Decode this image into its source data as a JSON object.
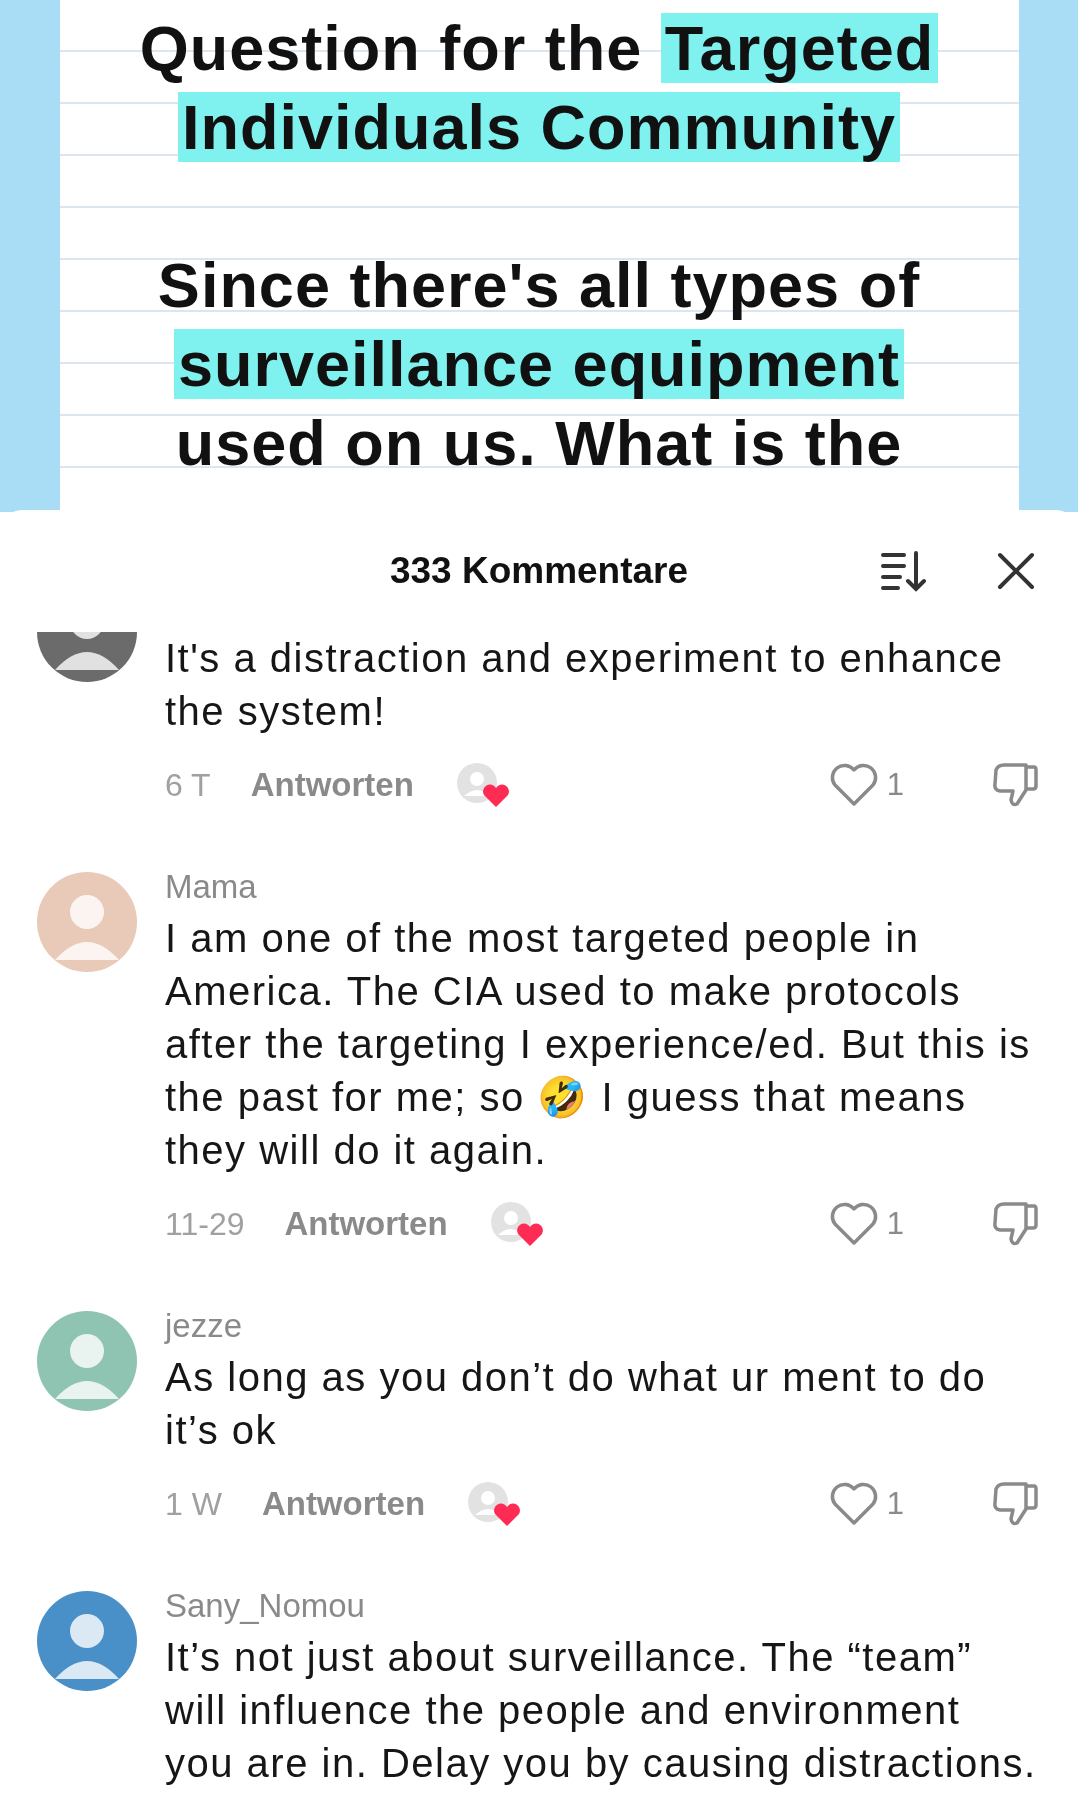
{
  "slide": {
    "paragraphs": [
      {
        "lines": [
          [
            {
              "text": "Question for the ",
              "highlighted": false
            },
            {
              "text": "Targeted",
              "highlighted": true
            }
          ],
          [
            {
              "text": "Individuals Community",
              "highlighted": true
            }
          ]
        ]
      },
      {
        "lines": [
          [
            {
              "text": "Since there's all types of",
              "highlighted": false
            }
          ],
          [
            {
              "text": "surveillance equipment",
              "highlighted": true
            }
          ],
          [
            {
              "text": "used on us. What is the",
              "highlighted": false
            }
          ]
        ]
      }
    ]
  },
  "comments_sheet": {
    "title": "333 Kommentare",
    "comments": [
      {
        "text": "It's a distraction and experiment to enhance the system!",
        "time": "6 T",
        "reply": "Antworten",
        "liked_by_creator": true,
        "liked": false,
        "likes": "1"
      },
      {
        "username": "Mama",
        "text": "I am one of the most targeted people in America. The CIA used to make protocols after the targeting I experience/ed. But this is the past for me; so 🤣 I guess that means they will do it again.",
        "time": "11-29",
        "reply": "Antworten",
        "liked_by_creator": true,
        "liked": false,
        "likes": "1"
      },
      {
        "username": "jezze",
        "text": "As long as you don’t do what ur ment to do it’s ok",
        "time": "1 W",
        "reply": "Antworten",
        "liked_by_creator": true,
        "liked": false,
        "likes": "1"
      },
      {
        "username": "Sany_Nomou",
        "text": "It’s not just about surveillance. The “team” will influence the people and environment you are in. Delay you by causing distractions."
      }
    ]
  }
}
